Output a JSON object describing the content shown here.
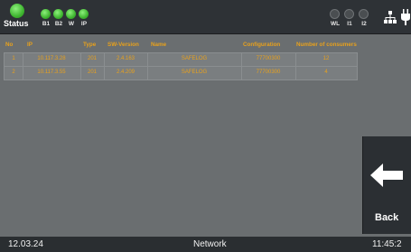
{
  "status": {
    "label": "Status",
    "indicators_left": [
      {
        "label": "B1",
        "state": "on"
      },
      {
        "label": "B2",
        "state": "on"
      },
      {
        "label": "W",
        "state": "on"
      },
      {
        "label": "IP",
        "state": "on"
      }
    ],
    "indicators_right": [
      {
        "label": "WL",
        "state": "off"
      },
      {
        "label": "I1",
        "state": "off"
      },
      {
        "label": "I2",
        "state": "off"
      }
    ],
    "icons": [
      "network-icon",
      "plug-icon"
    ]
  },
  "table": {
    "headers": {
      "no": "No",
      "ip": "IP",
      "type": "Type",
      "sw_version": "SW-Version",
      "name": "Name",
      "configuration": "Configuration",
      "consumers": "Number of consumers"
    },
    "rows": [
      {
        "no": "1",
        "ip": "10.117.3.28",
        "type": "201",
        "sw_version": "2.4.163",
        "name": "SAFELOG",
        "configuration": "77700300",
        "consumers": "12"
      },
      {
        "no": "2",
        "ip": "10.117.3.55",
        "type": "201",
        "sw_version": "2.4.209",
        "name": "SAFELOG",
        "configuration": "77700300",
        "consumers": "4"
      }
    ]
  },
  "back_button": {
    "label": "Back",
    "icon": "arrow-left-icon"
  },
  "footer": {
    "date": "12.03.24",
    "title": "Network",
    "time": "11:45:2"
  },
  "colors": {
    "accent": "#e8a11c",
    "led_on": "#3fb530",
    "background": "#6a6e70",
    "bar": "#2e3236"
  }
}
